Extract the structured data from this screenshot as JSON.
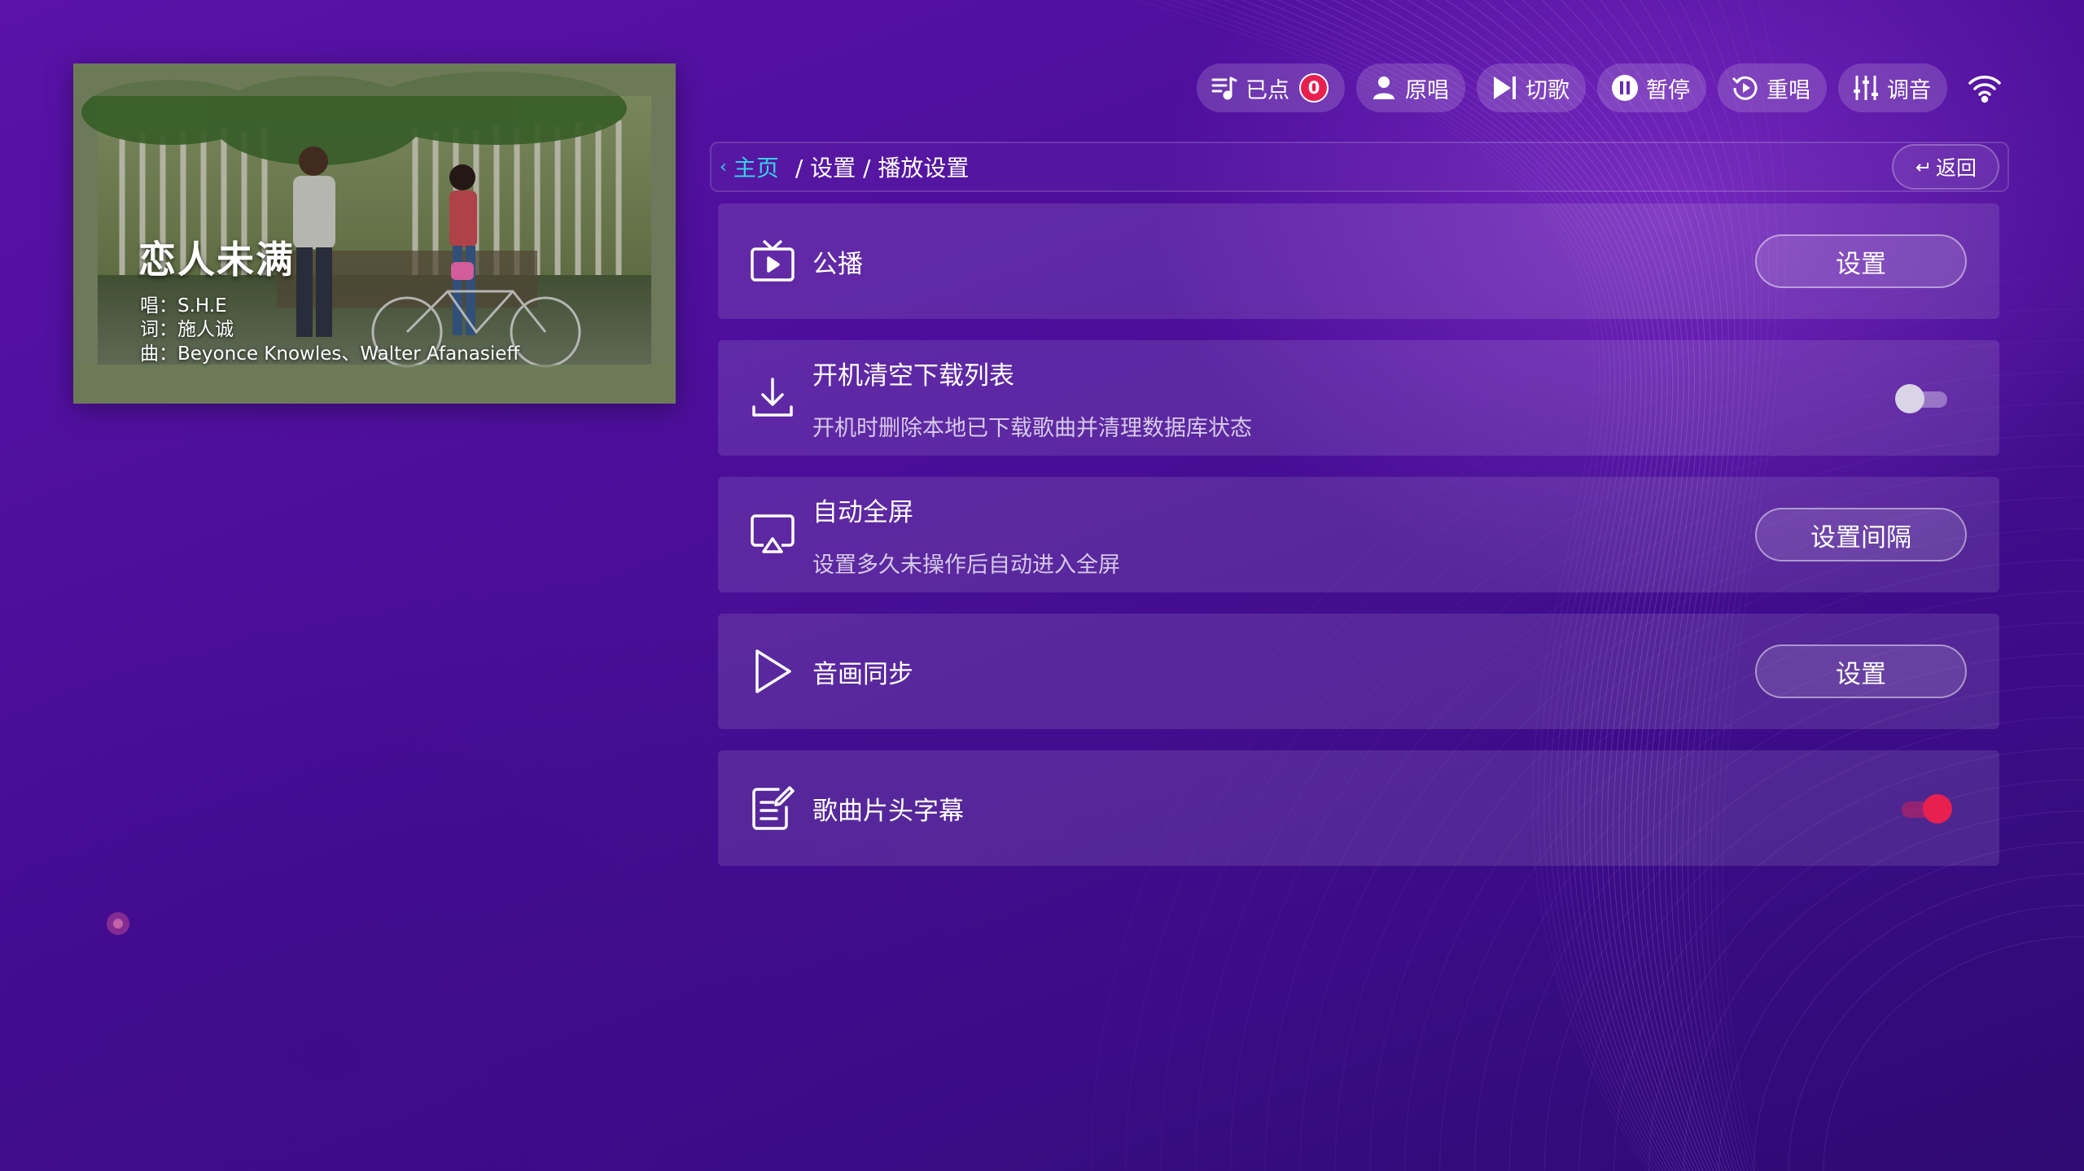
{
  "now_playing": {
    "title": "恋人未满",
    "singer_line": "唱：S.H.E",
    "lyricist_line": "词：施人诚",
    "composer_line": "曲：Beyonce Knowles、Walter Afanasieff"
  },
  "toolbar": {
    "queued_label": "已点",
    "queued_count": "0",
    "original_label": "原唱",
    "skip_label": "切歌",
    "pause_label": "暂停",
    "replay_label": "重唱",
    "tune_label": "调音"
  },
  "breadcrumb": {
    "home": "主页",
    "path": "/ 设置 / 播放设置",
    "back_label": "返回"
  },
  "settings": {
    "broadcast": {
      "title": "公播",
      "button": "设置"
    },
    "clear_downloads": {
      "title": "开机清空下载列表",
      "subtitle": "开机时删除本地已下载歌曲并清理数据库状态",
      "enabled": false
    },
    "auto_fullscreen": {
      "title": "自动全屏",
      "subtitle": "设置多久未操作后自动进入全屏",
      "button": "设置间隔"
    },
    "av_sync": {
      "title": "音画同步",
      "button": "设置"
    },
    "intro_subtitles": {
      "title": "歌曲片头字幕",
      "enabled": true
    }
  },
  "colors": {
    "accent": "#e8204f",
    "link": "#35d2e8",
    "background": "#4a0e98"
  }
}
